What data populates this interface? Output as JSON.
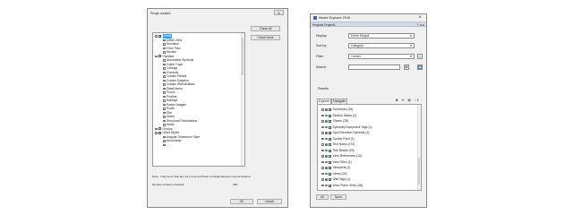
{
  "purge": {
    "title": "Purge unused",
    "close_glyph": "⨯",
    "check_all_label": "Check All",
    "check_none_label": "Check None",
    "tree": [
      {
        "label": "Views",
        "level": 0,
        "selected": true,
        "expander": "−",
        "checkbox": true
      },
      {
        "label": "Detail View",
        "level": 1,
        "expander": "+"
      },
      {
        "label": "Elevation",
        "level": 1,
        "expander": "+"
      },
      {
        "label": "Floor Plan",
        "level": 1,
        "expander": "+"
      },
      {
        "label": "Section",
        "level": 1,
        "expander": "+"
      },
      {
        "label": "Families",
        "level": 0,
        "expander": "−",
        "checkbox": true
      },
      {
        "label": "Annotation Symbols",
        "level": 1,
        "expander": "+"
      },
      {
        "label": "Cable Trays",
        "level": 1,
        "expander": "+"
      },
      {
        "label": "Ceilings",
        "level": 1,
        "expander": "+"
      },
      {
        "label": "Conduits",
        "level": 1,
        "expander": "+"
      },
      {
        "label": "Curtain Panels",
        "level": 1,
        "expander": "+"
      },
      {
        "label": "Curtain Systems",
        "level": 1,
        "expander": "+"
      },
      {
        "label": "Curtain Wall Mullions",
        "level": 1,
        "expander": "+"
      },
      {
        "label": "Detail Items",
        "level": 1,
        "expander": "+"
      },
      {
        "label": "Floors",
        "level": 1,
        "expander": "+"
      },
      {
        "label": "Profiles",
        "level": 1,
        "expander": "+"
      },
      {
        "label": "Railings",
        "level": 1,
        "expander": "+"
      },
      {
        "label": "Raster Images",
        "level": 1,
        "expander": "+"
      },
      {
        "label": "Roofs",
        "level": 1,
        "expander": "+"
      },
      {
        "label": "Site",
        "level": 1,
        "expander": "+"
      },
      {
        "label": "Stairs",
        "level": 1,
        "expander": "+"
      },
      {
        "label": "Structural Foundations",
        "level": 1,
        "expander": "+"
      },
      {
        "label": "Walls",
        "level": 1,
        "expander": "+"
      },
      {
        "label": "Groups",
        "level": 0,
        "expander": "+",
        "checkbox": true
      },
      {
        "label": "Other Styles",
        "level": 0,
        "expander": "−",
        "checkbox": true
      },
      {
        "label": "Angular Dimension Style",
        "level": 1,
        "expander": "+"
      },
      {
        "label": "Arrowhead",
        "level": 1,
        "expander": "+"
      },
      {
        "label": "...",
        "level": 1,
        "expander": "+"
      }
    ],
    "note": "Note - Only items that are not in use and have no dependencies may be deleted",
    "count_label": "Number of items checked:",
    "count_value": "465",
    "ok_label": "OK",
    "cancel_label": "Cancel"
  },
  "explorer": {
    "title": "Ideate Explorer 2016",
    "close_glyph": "⨯",
    "project_label": "Projects Project1",
    "header_controls": "? ✕ ▸",
    "display_label": "Display:",
    "display_value": "Entire Project",
    "sort_label": "Sort by:",
    "sort_value": "Category",
    "filter_label": "Filter:",
    "filter_value": "<none>",
    "filter_btn": "...",
    "search_label": "Search:",
    "search_value": "",
    "search_btn1": "⌘",
    "search_btn2": "◉",
    "results_label": "Results",
    "tab_explorer": "Explorer",
    "tab_navigate": "Navigate",
    "tab_tools": "✖ ⟳ ▤ ↑▾",
    "list": [
      {
        "label": "Schedules (33)"
      },
      {
        "label": "Section Marks (2)"
      },
      {
        "label": "Sheets (28)"
      },
      {
        "label": "Specialty Equipment Tags (1)"
      },
      {
        "label": "Spot Elevation Symbols (1)"
      },
      {
        "label": "Survey Point (1)"
      },
      {
        "label": "Text Notes (474)"
      },
      {
        "label": "Title Blocks (25)"
      },
      {
        "label": "View References (10)"
      },
      {
        "label": "View Titles (1)"
      },
      {
        "label": "Viewports (1)"
      },
      {
        "label": "Views (28)"
      },
      {
        "label": "Wall Tags (1)"
      },
      {
        "label": "Work Plane Grids (48)"
      }
    ],
    "all_label": "All",
    "none_label": "None"
  }
}
